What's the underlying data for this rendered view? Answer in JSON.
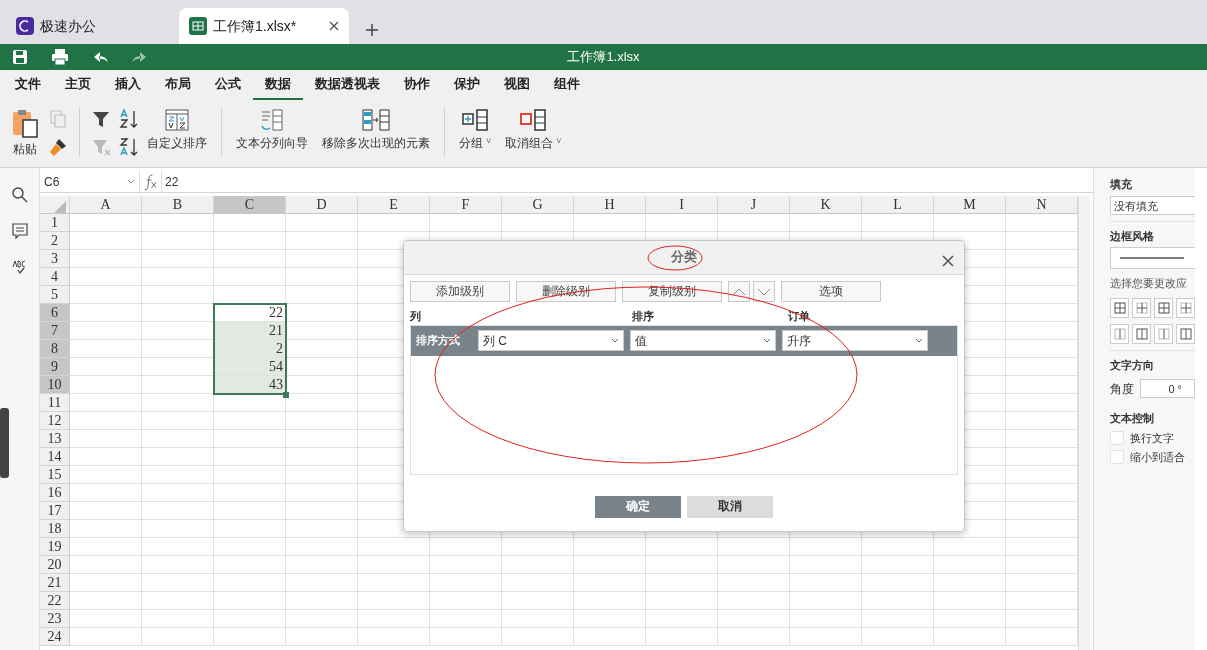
{
  "tabs": [
    {
      "label": "极速办公",
      "kind": "app",
      "selected": false
    },
    {
      "label": "工作簿1.xlsx*",
      "kind": "document",
      "selected": true
    }
  ],
  "title": "工作簿1.xlsx",
  "menu": [
    {
      "label": "文件",
      "selected": false
    },
    {
      "label": "主页",
      "selected": false
    },
    {
      "label": "插入",
      "selected": false
    },
    {
      "label": "布局",
      "selected": false
    },
    {
      "label": "公式",
      "selected": false
    },
    {
      "label": "数据",
      "selected": true
    },
    {
      "label": "数据透视表",
      "selected": false
    },
    {
      "label": "协作",
      "selected": false
    },
    {
      "label": "保护",
      "selected": false
    },
    {
      "label": "视图",
      "selected": false
    },
    {
      "label": "组件",
      "selected": false
    }
  ],
  "ribbon": {
    "paste": "粘贴",
    "custom_sort": "自定义排序",
    "text_to_columns": "文本分列向导",
    "remove_duplicates": "移除多次出现的元素",
    "group": "分组",
    "ungroup": "取消组合",
    "caret": "˅"
  },
  "name_box": "C6",
  "formula": "22",
  "columns": [
    {
      "label": "A",
      "selected": false
    },
    {
      "label": "B",
      "selected": false
    },
    {
      "label": "C",
      "selected": true
    },
    {
      "label": "D",
      "selected": false
    },
    {
      "label": "E",
      "selected": false
    },
    {
      "label": "F",
      "selected": false
    },
    {
      "label": "G",
      "selected": false
    },
    {
      "label": "H",
      "selected": false
    },
    {
      "label": "I",
      "selected": false
    },
    {
      "label": "J",
      "selected": false
    },
    {
      "label": "K",
      "selected": false
    },
    {
      "label": "L",
      "selected": false
    },
    {
      "label": "M",
      "selected": false
    },
    {
      "label": "N",
      "selected": false
    }
  ],
  "rows": [
    {
      "label": "1",
      "selected": false
    },
    {
      "label": "2",
      "selected": false
    },
    {
      "label": "3",
      "selected": false
    },
    {
      "label": "4",
      "selected": false
    },
    {
      "label": "5",
      "selected": false
    },
    {
      "label": "6",
      "selected": true
    },
    {
      "label": "7",
      "selected": true
    },
    {
      "label": "8",
      "selected": true
    },
    {
      "label": "9",
      "selected": true
    },
    {
      "label": "10",
      "selected": true
    },
    {
      "label": "11",
      "selected": false
    },
    {
      "label": "12",
      "selected": false
    },
    {
      "label": "13",
      "selected": false
    },
    {
      "label": "14",
      "selected": false
    },
    {
      "label": "15",
      "selected": false
    },
    {
      "label": "16",
      "selected": false
    },
    {
      "label": "17",
      "selected": false
    },
    {
      "label": "18",
      "selected": false
    },
    {
      "label": "19",
      "selected": false
    },
    {
      "label": "20",
      "selected": false
    },
    {
      "label": "21",
      "selected": false
    },
    {
      "label": "22",
      "selected": false
    },
    {
      "label": "23",
      "selected": false
    },
    {
      "label": "24",
      "selected": false
    }
  ],
  "selection_values": [
    "22",
    "21",
    "2",
    "54",
    "43"
  ],
  "right_panel": {
    "fill_label": "填充",
    "fill_value": "没有填充",
    "border_label": "边框风格",
    "border_hint": "选择您要更改应",
    "direction_label": "文字方向",
    "angle_label": "角度",
    "angle_value": "0 °",
    "text_control_label": "文本控制",
    "checkboxes": [
      {
        "label": "换行文字",
        "checked": false
      },
      {
        "label": "缩小到适合",
        "checked": false
      }
    ]
  },
  "dialog": {
    "title": "分类",
    "toolbar": [
      "添加级别",
      "删除级别",
      "复制级别"
    ],
    "options": "选项",
    "headers": [
      "列",
      "排序",
      "订单"
    ],
    "row_label": "排序方式",
    "selects": [
      "列 C",
      "值",
      "升序"
    ],
    "buttons": [
      {
        "label": "确定",
        "kind": "primary"
      },
      {
        "label": "取消",
        "kind": "secondary"
      }
    ]
  }
}
